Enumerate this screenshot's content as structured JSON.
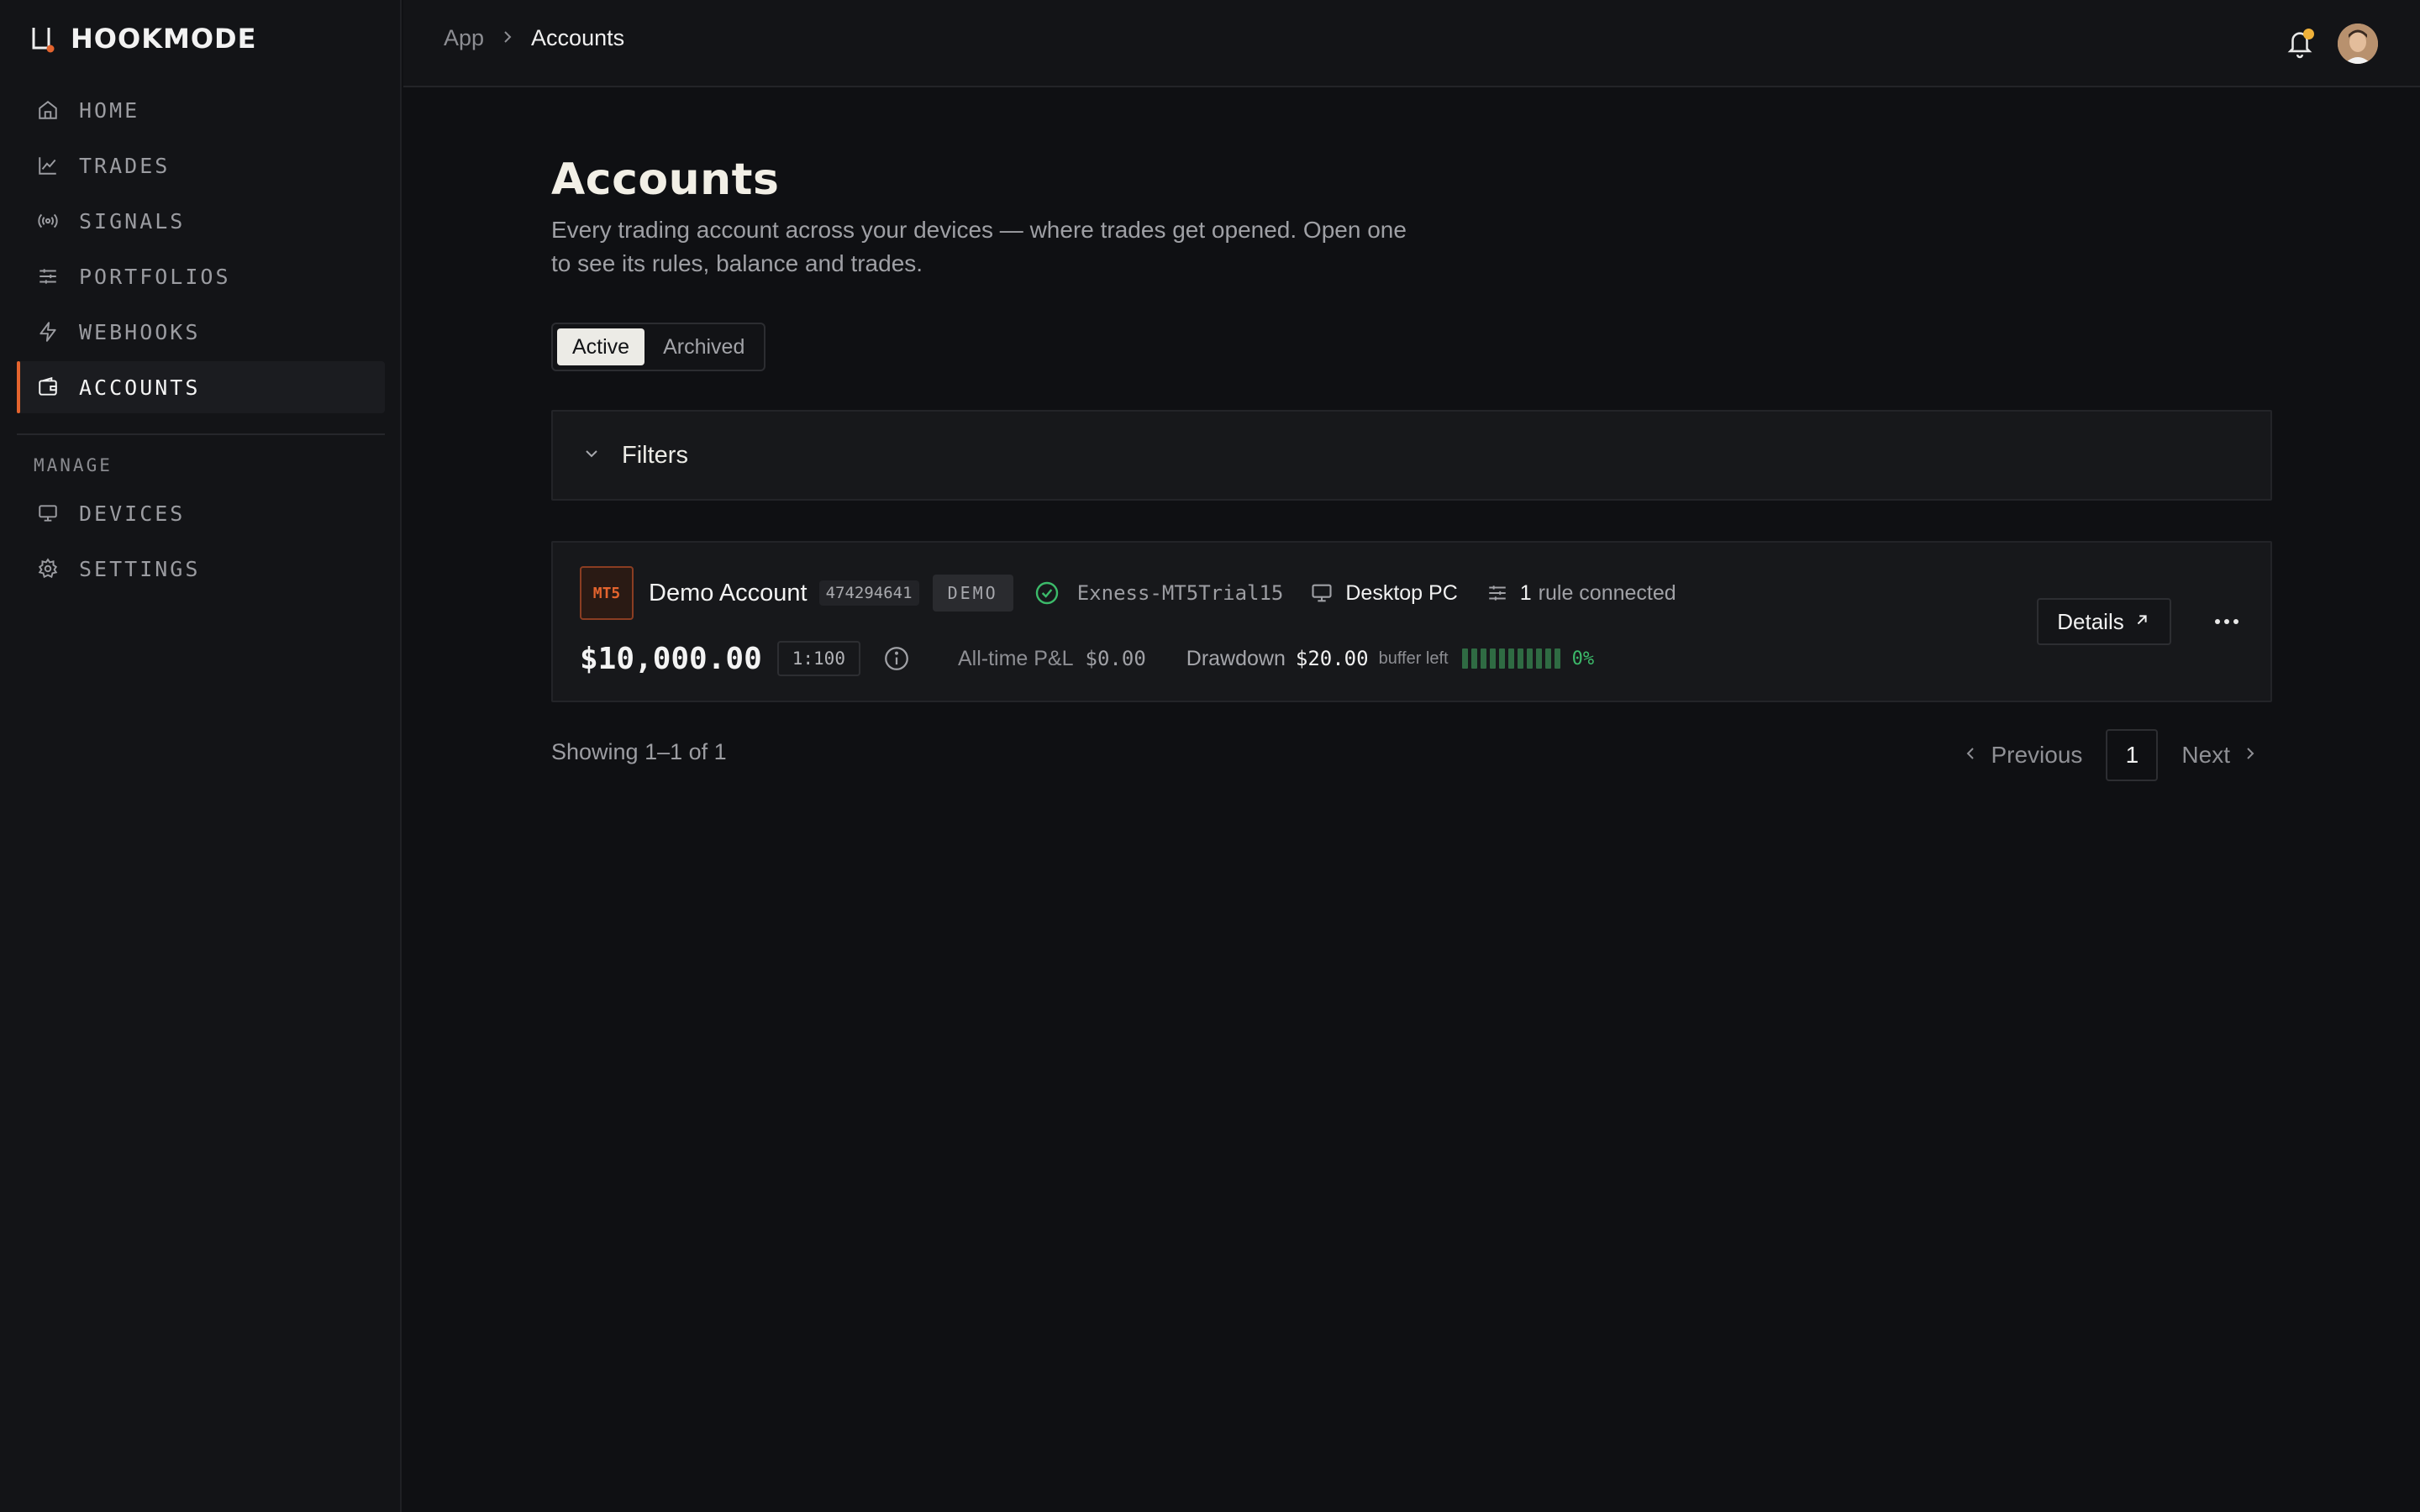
{
  "brand": {
    "name": "HOOKMODE",
    "accent": "#e4642e"
  },
  "sidebar": {
    "items": [
      {
        "label": "HOME",
        "icon": "home-icon"
      },
      {
        "label": "TRADES",
        "icon": "chart-line-icon"
      },
      {
        "label": "SIGNALS",
        "icon": "broadcast-icon"
      },
      {
        "label": "PORTFOLIOS",
        "icon": "sliders-icon"
      },
      {
        "label": "WEBHOOKS",
        "icon": "bolt-icon"
      },
      {
        "label": "ACCOUNTS",
        "icon": "wallet-icon",
        "active": true
      }
    ],
    "section_label": "MANAGE",
    "manage_items": [
      {
        "label": "DEVICES",
        "icon": "monitor-icon"
      },
      {
        "label": "SETTINGS",
        "icon": "gear-icon"
      }
    ]
  },
  "header": {
    "breadcrumb": [
      "App",
      "Accounts"
    ],
    "notification_dot_color": "#f0b23a"
  },
  "page": {
    "title": "Accounts",
    "subtitle": "Every trading account across your devices — where trades get opened. Open one to see its rules, balance and trades.",
    "tabs": [
      {
        "label": "Active",
        "selected": true
      },
      {
        "label": "Archived",
        "selected": false
      }
    ],
    "filters_label": "Filters"
  },
  "accounts": [
    {
      "platform": "MT5",
      "name": "Demo Account",
      "number": "474294641",
      "type_badge": "DEMO",
      "server": "Exness-MT5Trial15",
      "device": "Desktop PC",
      "rules_count": "1",
      "rules_text": "rule connected",
      "balance": "$10,000.00",
      "leverage": "1:100",
      "pnl_label": "All-time P&L",
      "pnl_value": "$0.00",
      "drawdown_label": "Drawdown",
      "drawdown_value": "$20.00",
      "buffer_label": "buffer left",
      "drawdown_percent_text": "0%",
      "drawdown_percent": 0,
      "details_label": "Details",
      "status_color": "#3cba6a"
    }
  ],
  "pagination": {
    "showing": "Showing 1–1 of 1",
    "previous": "Previous",
    "current": "1",
    "next": "Next"
  }
}
